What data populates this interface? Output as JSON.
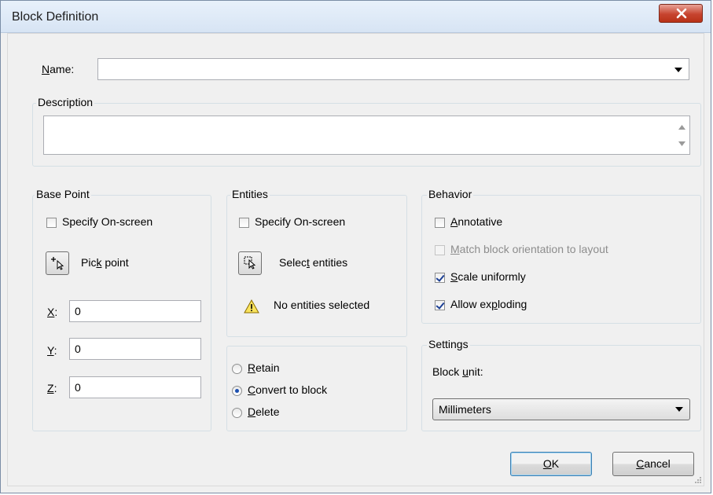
{
  "window": {
    "title": "Block Definition"
  },
  "name": {
    "pre": "",
    "key": "N",
    "post": "ame:",
    "value": ""
  },
  "description": {
    "label": "Description",
    "value": ""
  },
  "base_point": {
    "title": "Base Point",
    "specify_onscreen": "Specify On-screen",
    "pick_point_pre": "Pic",
    "pick_point_key": "k",
    "pick_point_post": " point",
    "x": {
      "key": "X",
      "suffix": ":",
      "value": "0"
    },
    "y": {
      "key": "Y",
      "suffix": ":",
      "value": "0"
    },
    "z": {
      "key": "Z",
      "suffix": ":",
      "value": "0"
    }
  },
  "entities": {
    "title": "Entities",
    "specify_onscreen": "Specify On-screen",
    "select_pre": "Selec",
    "select_key": "t",
    "select_post": " entities",
    "status": "No entities selected"
  },
  "entity_action": {
    "retain_key": "R",
    "retain_post": "etain",
    "convert_key": "C",
    "convert_post": "onvert to block",
    "delete_key": "D",
    "delete_post": "elete"
  },
  "behavior": {
    "title": "Behavior",
    "annotative_key": "A",
    "annotative_post": "nnotative",
    "match_key": "M",
    "match_post": "atch block orientation to layout",
    "scale_key": "S",
    "scale_post": "cale uniformly",
    "explode_pre": "Allow ex",
    "explode_key": "p",
    "explode_post": "loding"
  },
  "settings": {
    "title": "Settings",
    "block_unit_pre": "Block ",
    "block_unit_key": "u",
    "block_unit_post": "nit:",
    "unit_value": "Millimeters"
  },
  "buttons": {
    "ok_key": "O",
    "ok_post": "K",
    "cancel_key": "C",
    "cancel_post": "ancel"
  }
}
